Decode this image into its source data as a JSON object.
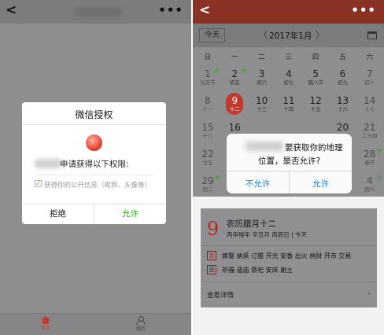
{
  "left": {
    "nav": {
      "back_icon": "chevron-left",
      "more_icon": "more-dots",
      "more": "•••"
    },
    "dialog": {
      "title": "微信授权",
      "request": "申请获得以下权限:",
      "permission": "获得你的公开信息（昵称、头像等）",
      "check": "✓",
      "deny": "拒绝",
      "allow": "允许"
    },
    "tabbar": {
      "home": "首页",
      "me": "我的"
    },
    "colors": {
      "allow": "#2aa515",
      "home_active": "#c63b2b"
    }
  },
  "right": {
    "nav": {
      "back_icon": "chevron-left",
      "more": "•••"
    },
    "header": {
      "today": "今天",
      "prev": "〈",
      "month": "2017年1月",
      "next": "〉",
      "calendar_icon": "calendar-icon"
    },
    "weekdays": [
      "日",
      "一",
      "二",
      "三",
      "四",
      "五",
      "六"
    ],
    "weeks": [
      [
        {
          "n": "1",
          "l": "元旦节",
          "r": "休"
        },
        {
          "n": "2",
          "l": "初五",
          "r": "休"
        },
        {
          "n": "3",
          "l": "初六"
        },
        {
          "n": "4",
          "l": "初七"
        },
        {
          "n": "5",
          "l": "腊八节"
        },
        {
          "n": "6",
          "l": "初九"
        },
        {
          "n": "7",
          "l": "初十"
        }
      ],
      [
        {
          "n": "8",
          "l": "十一"
        },
        {
          "n": "9",
          "l": "十二"
        },
        {
          "n": "10",
          "l": "十三"
        },
        {
          "n": "11",
          "l": "十四"
        },
        {
          "n": "12",
          "l": "十五"
        },
        {
          "n": "13",
          "l": "十六"
        },
        {
          "n": "14",
          "l": "十七"
        }
      ],
      [
        {
          "n": "15",
          "l": "十八"
        },
        {
          "n": "16",
          "l": "十九"
        },
        {
          "n": "",
          "l": ""
        },
        {
          "n": "",
          "l": ""
        },
        {
          "n": "",
          "l": ""
        },
        {
          "n": "20",
          "l": "二十三"
        },
        {
          "n": "21",
          "l": "二十四"
        }
      ],
      [
        {
          "n": "22",
          "l": "廿五"
        },
        {
          "n": "",
          "l": ""
        },
        {
          "n": "",
          "l": ""
        },
        {
          "n": "",
          "l": ""
        },
        {
          "n": "",
          "l": ""
        },
        {
          "n": "",
          "l": ""
        },
        {
          "n": "28",
          "l": "春节",
          "r": "休"
        }
      ],
      [
        {
          "n": "29",
          "l": "初二",
          "r": "休"
        },
        {
          "n": "",
          "l": ""
        },
        {
          "n": "",
          "l": ""
        },
        {
          "n": "",
          "l": ""
        },
        {
          "n": "",
          "l": ""
        },
        {
          "n": "",
          "l": ""
        },
        {
          "n": "4",
          "l": "初八",
          "r": "班"
        }
      ]
    ],
    "dialog": {
      "line1": "要获取你的地理",
      "line2": "位置，是否允许?",
      "deny": "不允许",
      "allow": "允许"
    },
    "card": {
      "day": "9",
      "lunar": "农历腊月十二",
      "ganzhi": "丙申猴年 辛丑月 丙辰日 | 今天",
      "yi": "宜",
      "yi_items": "嫁娶 纳采 订盟 开光 安香 出火 纳财 开市 交易",
      "ji": "忌",
      "ji_items": "祈福 造庙 祭祀 安床 谢土",
      "detail": "查看详情",
      "chevron": "›"
    },
    "colors": {
      "nav": "#8a3224",
      "selected": "#c0392b",
      "link": "#1a7fe0"
    }
  }
}
